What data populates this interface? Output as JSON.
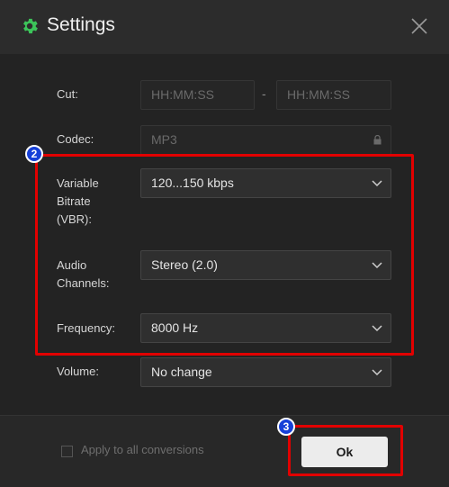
{
  "window": {
    "title": "Settings",
    "icon": "gear-icon"
  },
  "form": {
    "cut": {
      "label": "Cut:",
      "start_placeholder": "HH:MM:SS",
      "end_placeholder": "HH:MM:SS",
      "separator": "-"
    },
    "codec": {
      "label": "Codec:",
      "value": "MP3"
    },
    "bitrate": {
      "label_lines": [
        "Variable",
        "Bitrate",
        "(VBR):"
      ],
      "value": "120...150 kbps"
    },
    "channels": {
      "label_lines": [
        "Audio",
        "Channels:"
      ],
      "value": "Stereo (2.0)"
    },
    "frequency": {
      "label": "Frequency:",
      "value": "8000 Hz"
    },
    "volume": {
      "label": "Volume:",
      "value": "No change"
    }
  },
  "annotations": {
    "badge_2": "2",
    "badge_3": "3",
    "highlight_color": "#e20000",
    "badge_color": "#1640d8"
  },
  "footer": {
    "apply_all_label": "Apply to all conversions",
    "apply_all_checked": false,
    "ok_label": "Ok"
  }
}
